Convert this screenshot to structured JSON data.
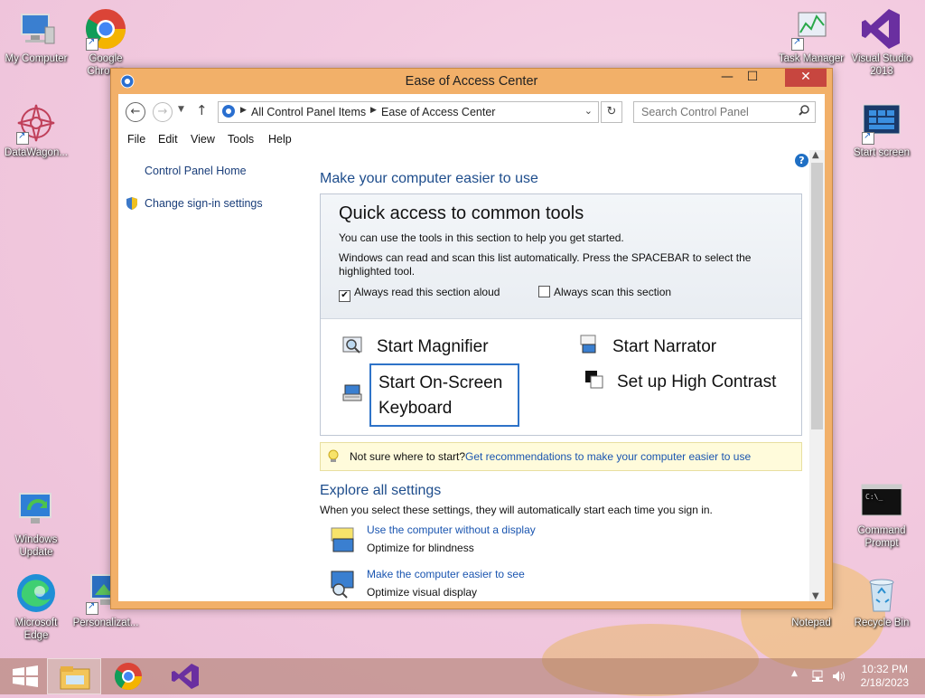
{
  "desktop": {
    "icons_left": [
      {
        "label": "My Computer"
      },
      {
        "label": "Google Chrome"
      },
      {
        "label": "DataWagon..."
      },
      {
        "label": "Windows Update"
      },
      {
        "label": "Microsoft Edge"
      },
      {
        "label": "Personalizat..."
      }
    ],
    "icons_right": [
      {
        "label": "Task Manager"
      },
      {
        "label": "Visual Studio 2013"
      },
      {
        "label": "Start screen"
      },
      {
        "label": "Command Prompt"
      },
      {
        "label": "Notepad"
      },
      {
        "label": "Recycle Bin"
      }
    ]
  },
  "window": {
    "title": "Ease of Access Center",
    "controls": {
      "minimize": "—",
      "maximize": "☐",
      "close": "✕"
    },
    "address": {
      "crumbs": [
        "All Control Panel Items",
        "Ease of Access Center"
      ],
      "search_placeholder": "Search Control Panel"
    },
    "menu": [
      "File",
      "Edit",
      "View",
      "Tools",
      "Help"
    ],
    "sidebar": {
      "home": "Control Panel Home",
      "sign_in": "Change sign-in settings"
    },
    "main": {
      "heading": "Make your computer easier to use",
      "quick_access": {
        "title": "Quick access to common tools",
        "line1": "You can use the tools in this section to help you get started.",
        "line2a": "Windows can read and scan this list automatically.  Press the SPACEBAR to select the",
        "line2b": "highlighted tool.",
        "check_read": {
          "label": "Always read this section aloud",
          "checked": true
        },
        "check_scan": {
          "label": "Always scan this section",
          "checked": false
        },
        "tools": {
          "magnifier": "Start Magnifier",
          "narrator": "Start Narrator",
          "osk_line1": "Start On-Screen",
          "osk_line2": "Keyboard",
          "contrast": "Set up High Contrast"
        }
      },
      "tip": {
        "text": "Not sure where to start?",
        "link": "Get recommendations to make your computer easier to use"
      },
      "explore": {
        "heading": "Explore all settings",
        "sub": "When you select these settings, they will automatically start each time you sign in.",
        "items": [
          {
            "link": "Use the computer without a display",
            "desc": "Optimize for blindness"
          },
          {
            "link": "Make the computer easier to see",
            "desc": "Optimize visual display"
          }
        ]
      }
    }
  },
  "taskbar": {
    "time": "10:32 PM",
    "date": "2/18/2023"
  }
}
